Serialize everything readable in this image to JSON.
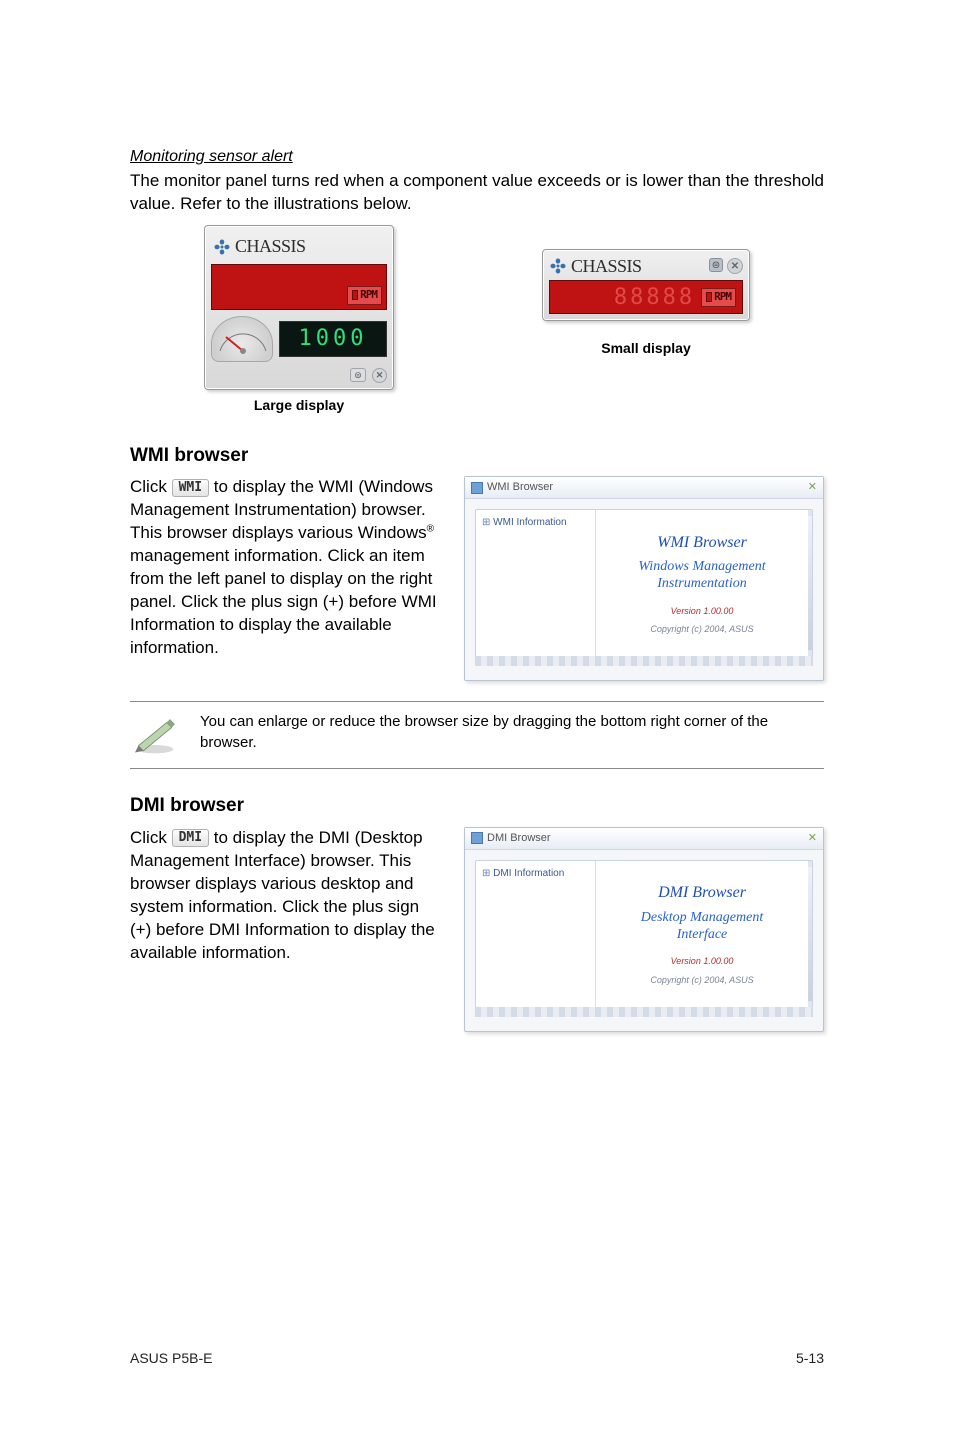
{
  "section1": {
    "heading": "Monitoring sensor alert",
    "body": "The monitor panel turns red when a component value exceeds or is lower than the threshold value. Refer to the illustrations below."
  },
  "widgets": {
    "chassis_label": "CHASSIS",
    "rpm_label": "RPM",
    "digits_large": "1000",
    "caption_large": "Large display",
    "caption_small": "Small display"
  },
  "wmi": {
    "heading": "WMI browser",
    "chip": "WMI",
    "p1a": "Click ",
    "p1b": " to display the WMI (Windows Management Instrumentation) browser. This browser displays various Windows",
    "sup": "®",
    "p1c": " management information. Click an item from the left panel to display on the right panel. Click the plus sign (+) before WMI Information to display the available information.",
    "win_title": "WMI Browser",
    "tree_root": "WMI Information",
    "big": "WMI  Browser",
    "sub1": "Windows Management",
    "sub2": "Instrumentation",
    "ver": "Version 1.00.00",
    "copy": "Copyright (c) 2004,  ASUS"
  },
  "note": {
    "text": "You can enlarge or reduce the browser size by dragging the bottom right corner of the browser."
  },
  "dmi": {
    "heading": "DMI browser",
    "chip": "DMI",
    "p1a": "Click ",
    "p1b": " to display the DMI (Desktop Management Interface) browser. This browser displays various desktop and system information. Click the plus sign (+) before DMI Information to display the available information.",
    "win_title": "DMI Browser",
    "tree_root": "DMI Information",
    "big": "DMI  Browser",
    "sub1": "Desktop Management",
    "sub2": "Interface",
    "ver": "Version 1.00.00",
    "copy": "Copyright (c) 2004,  ASUS"
  },
  "footer": {
    "left": "ASUS P5B-E",
    "right": "5-13"
  }
}
